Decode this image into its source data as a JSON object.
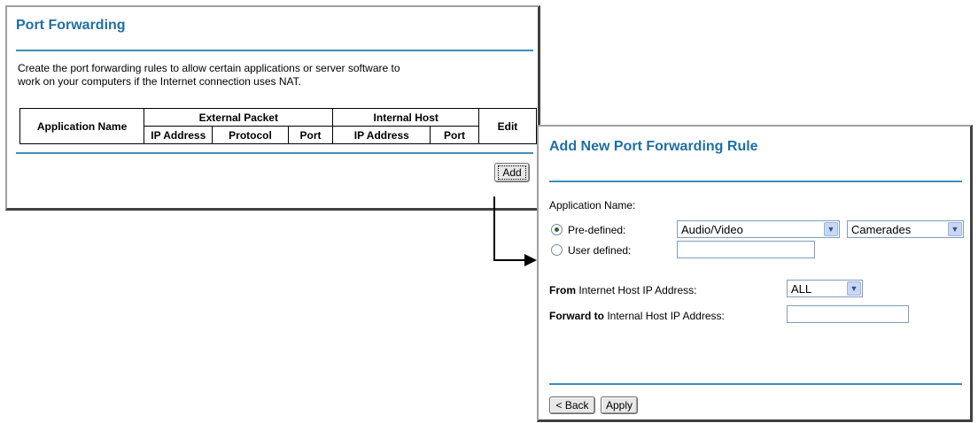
{
  "port_forwarding": {
    "title": "Port Forwarding",
    "description_line1": "Create the port forwarding rules to allow certain applications or server software to",
    "description_line2": "work on your computers if the Internet connection uses NAT.",
    "table": {
      "application_name": "Application Name",
      "external_packet": "External Packet",
      "internal_host": "Internal Host",
      "edit": "Edit",
      "sub_headers": [
        "IP Address",
        "Protocol",
        "Port",
        "IP Address",
        "Port"
      ]
    },
    "add_button": "Add"
  },
  "add_rule": {
    "title": "Add New Port Forwarding Rule",
    "application_name_label": "Application Name:",
    "predefined_label": "Pre-defined:",
    "user_defined_label": "User defined:",
    "category_select": "Audio/Video",
    "application_select": "Camerades",
    "user_defined_value": "",
    "from_label_bold": "From",
    "from_label_rest": " Internet Host IP Address:",
    "from_select": "ALL",
    "forward_label_bold": "Forward to",
    "forward_label_rest": " Internal Host IP Address:",
    "forward_value": "",
    "back_button": "< Back",
    "apply_button": "Apply"
  },
  "colors": {
    "title": "#1f6fa3",
    "rule": "#3b8fb7"
  }
}
